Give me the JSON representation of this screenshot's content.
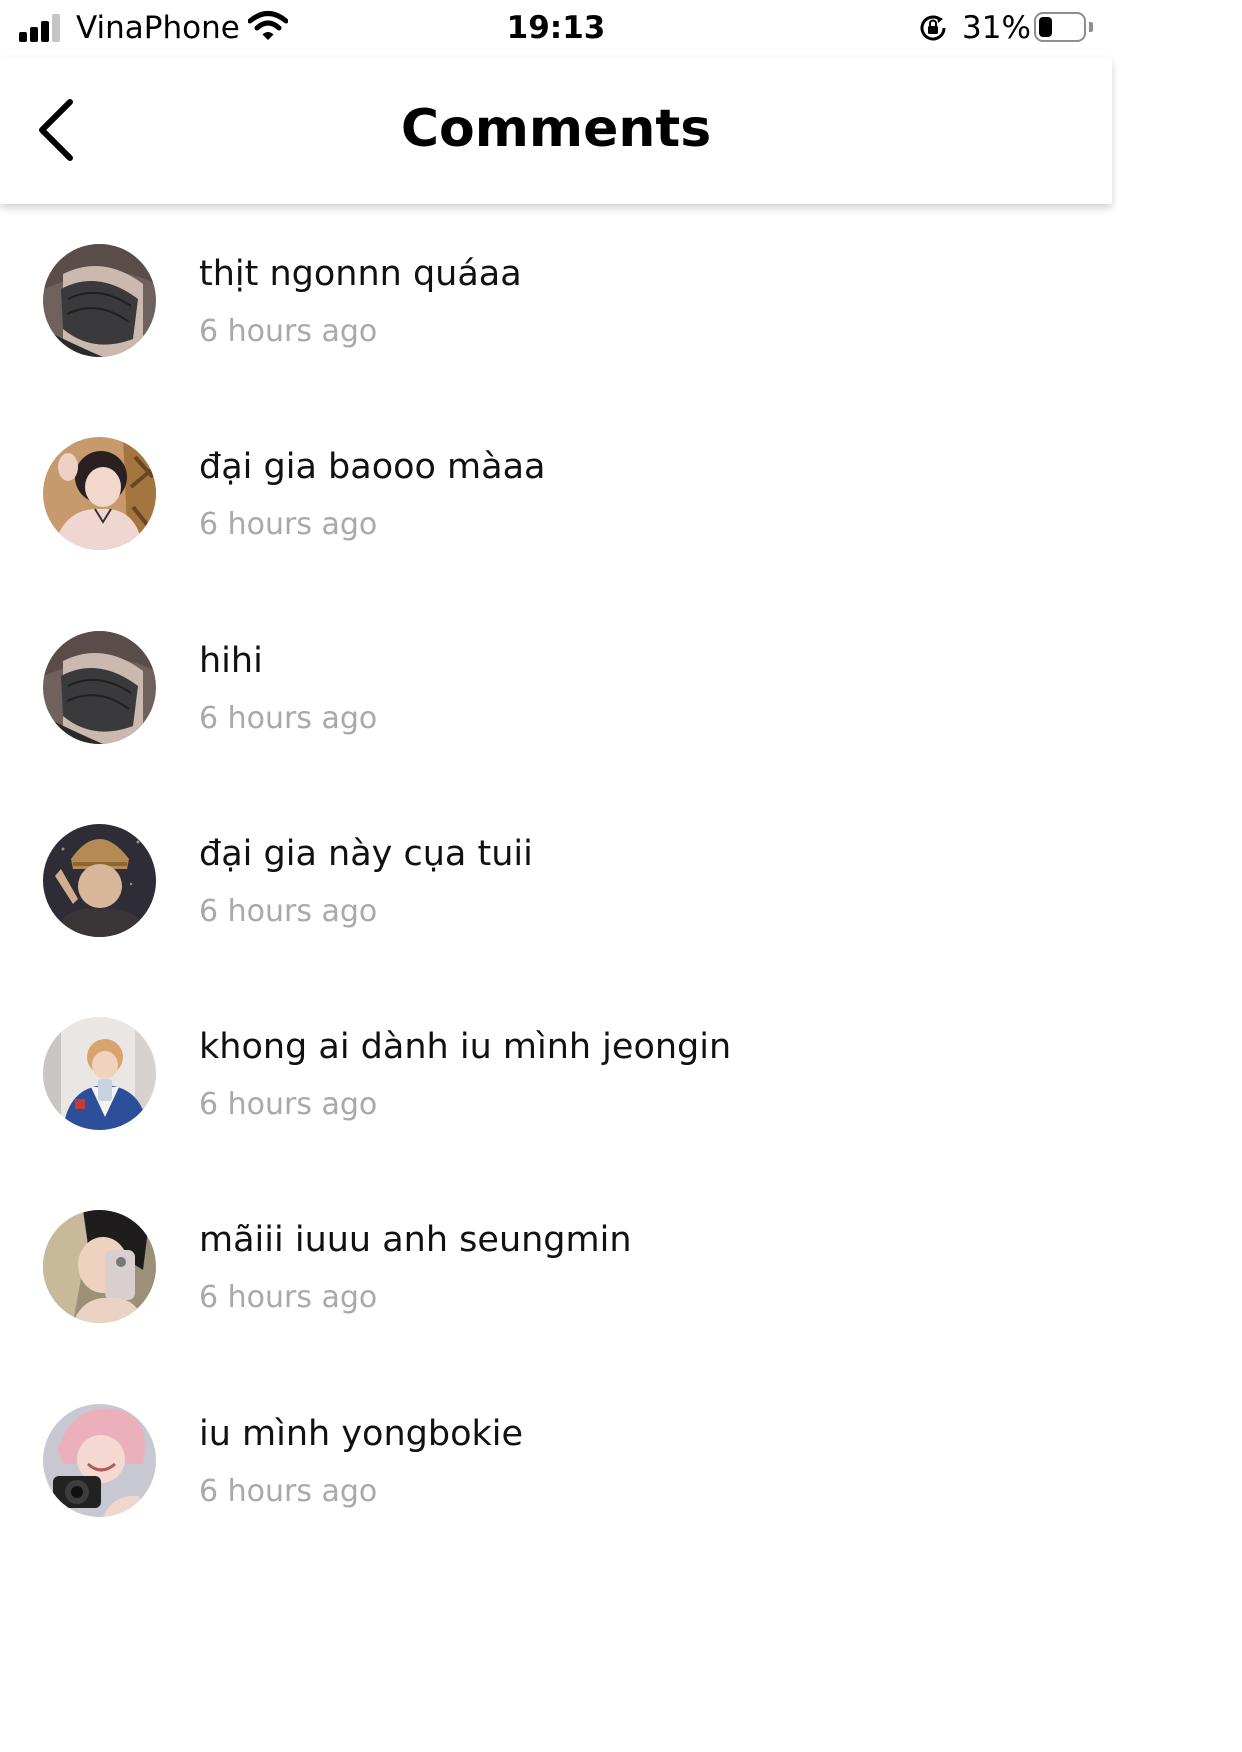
{
  "status_bar": {
    "carrier": "VinaPhone",
    "time": "19:13",
    "battery_percent": "31%",
    "battery_level": 0.31,
    "signal_bars": 3,
    "icons": [
      "signal-icon",
      "wifi-icon",
      "rotation-lock-icon",
      "battery-icon"
    ]
  },
  "header": {
    "title": "Comments",
    "back_icon": "chevron-left-icon"
  },
  "colors": {
    "time_text": "#a9a9a9",
    "divider_shadow": "#d0d0d0"
  },
  "comments": [
    {
      "text": "thịt ngonnn quáaa",
      "time": "6 hours ago",
      "avatar": "avatar-masked-person"
    },
    {
      "text": "đại gia baooo màaa",
      "time": "6 hours ago",
      "avatar": "avatar-person-pink-shirt"
    },
    {
      "text": "hihi",
      "time": "6 hours ago",
      "avatar": "avatar-masked-person"
    },
    {
      "text": "đại gia này cụa tuii",
      "time": "6 hours ago",
      "avatar": "avatar-person-beanie"
    },
    {
      "text": "khong ai dành iu mình jeongin",
      "time": "6 hours ago",
      "avatar": "avatar-person-mirror-selfie"
    },
    {
      "text": "mãiii iuuu anh seungmin",
      "time": "6 hours ago",
      "avatar": "avatar-person-phone"
    },
    {
      "text": "iu mình yongbokie",
      "time": "6 hours ago",
      "avatar": "avatar-person-camera"
    }
  ]
}
